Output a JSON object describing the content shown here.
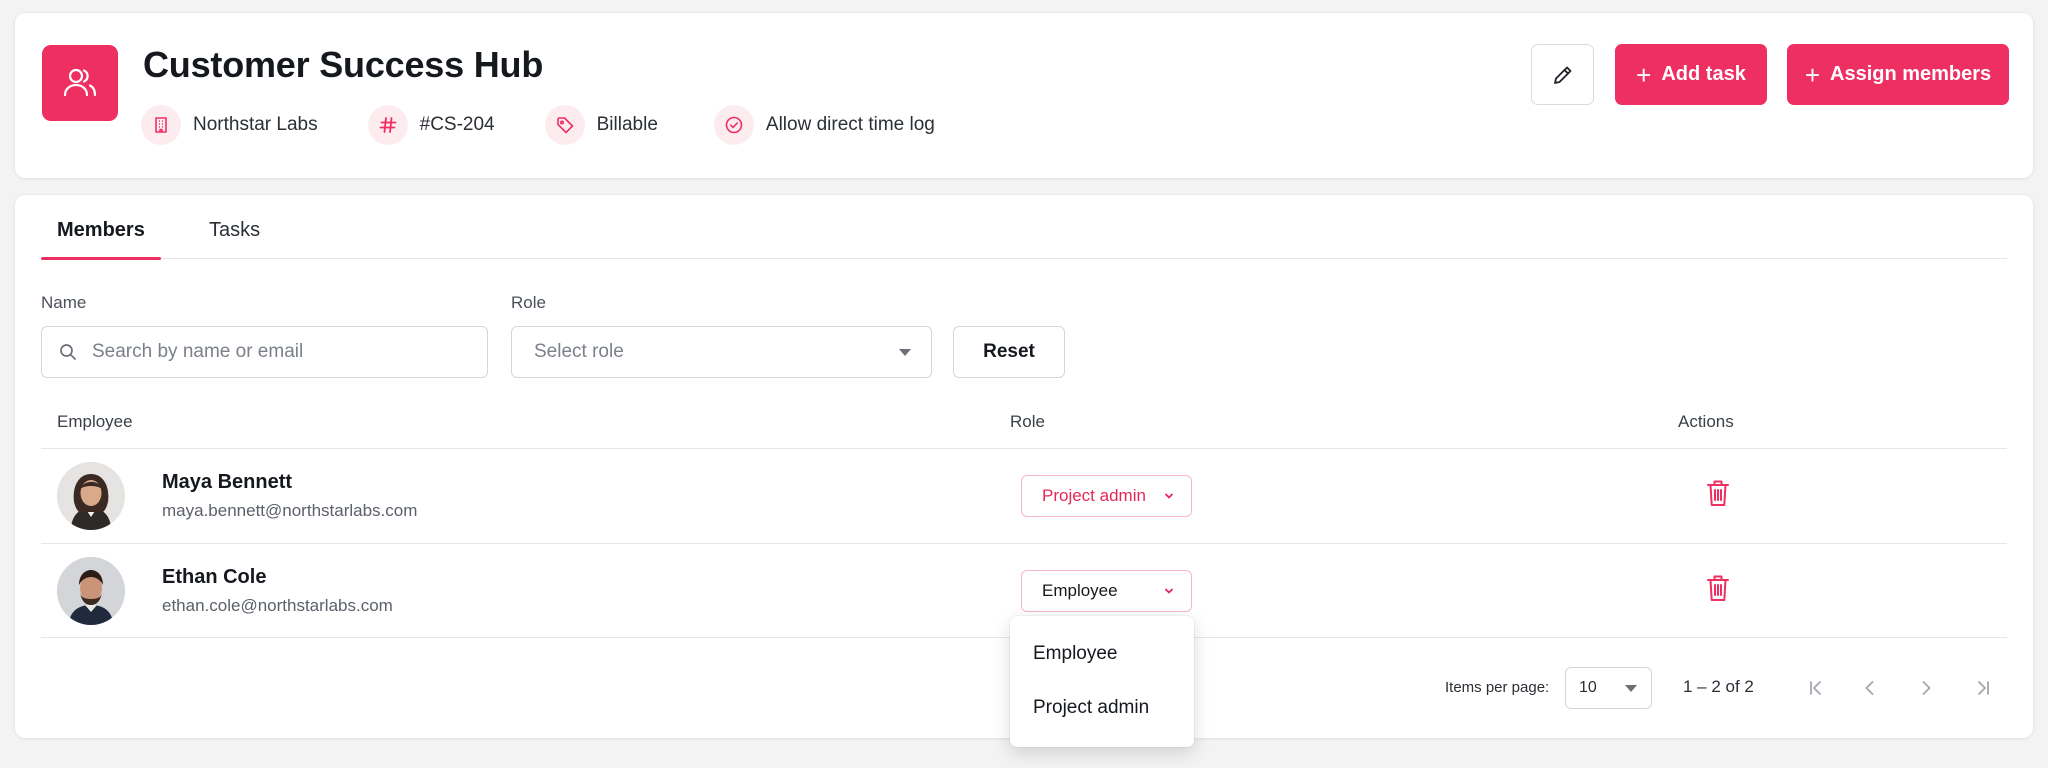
{
  "header": {
    "title": "Customer Success Hub",
    "logo_icon": "users-icon",
    "meta": [
      {
        "icon": "building-icon",
        "label": "Northstar Labs"
      },
      {
        "icon": "hash-icon",
        "label": "#CS-204"
      },
      {
        "icon": "tag-icon",
        "label": "Billable"
      },
      {
        "icon": "check-circle-icon",
        "label": "Allow direct time log"
      }
    ],
    "edit_icon": "pencil-icon",
    "add_task_label": "Add task",
    "assign_members_label": "Assign members"
  },
  "tabs": [
    {
      "label": "Members",
      "active": true
    },
    {
      "label": "Tasks",
      "active": false
    }
  ],
  "filters": {
    "name_label": "Name",
    "name_placeholder": "Search by name or email",
    "role_label": "Role",
    "role_placeholder": "Select role",
    "reset_label": "Reset"
  },
  "table": {
    "headers": {
      "employee": "Employee",
      "role": "Role",
      "actions": "Actions"
    },
    "rows": [
      {
        "name": "Maya Bennett",
        "email": "maya.bennett@northstarlabs.com",
        "role": "Project admin"
      },
      {
        "name": "Ethan Cole",
        "email": "ethan.cole@northstarlabs.com",
        "role": "Employee"
      }
    ]
  },
  "role_menu": {
    "options": [
      "Employee",
      "Project admin"
    ]
  },
  "pagination": {
    "items_per_page_label": "Items per page:",
    "items_per_page": "10",
    "range": "1 – 2 of 2"
  },
  "colors": {
    "accent": "#ee2f62",
    "accent_light": "#fdecef",
    "background": "#f3f3f4"
  }
}
